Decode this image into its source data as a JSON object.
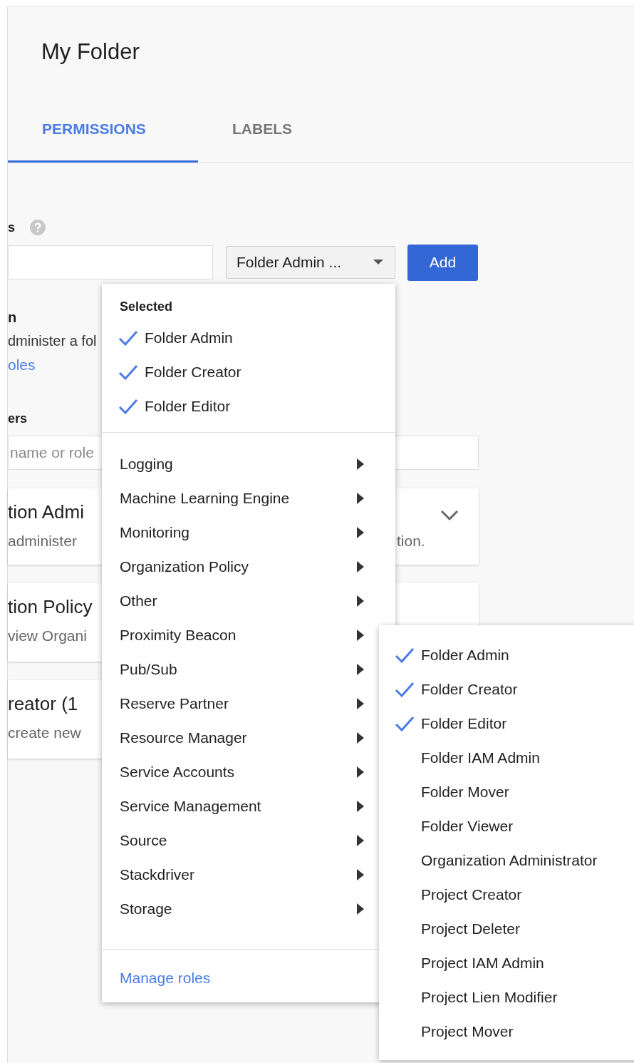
{
  "title": "My Folder",
  "tabs": [
    {
      "label": "PERMISSIONS",
      "selected": true
    },
    {
      "label": "LABELS",
      "selected": false
    }
  ],
  "add_members": {
    "label": "s",
    "role_dropdown": "Folder Admin ...",
    "add_button": "Add"
  },
  "role_info": {
    "title": "n",
    "description": "dminister a fol",
    "link": "oles"
  },
  "members": {
    "label": "ers",
    "filter_placeholder": "name or role"
  },
  "role_cards": [
    {
      "title": "tion Admi",
      "description": "administer",
      "description_end": "tion.",
      "expanded": false
    },
    {
      "title": "tion Policy",
      "description": "view Organi"
    },
    {
      "title": "reator (1",
      "description": "create new"
    }
  ],
  "role_menu": {
    "selected_heading": "Selected",
    "selected": [
      {
        "label": "Folder Admin",
        "checked": true
      },
      {
        "label": "Folder Creator",
        "checked": true
      },
      {
        "label": "Folder Editor",
        "checked": true
      }
    ],
    "categories": [
      "Logging",
      "Machine Learning Engine",
      "Monitoring",
      "Organization Policy",
      "Other",
      "Proximity Beacon",
      "Pub/Sub",
      "Reserve Partner",
      "Resource Manager",
      "Service Accounts",
      "Service Management",
      "Source",
      "Stackdriver",
      "Storage"
    ],
    "manage_link": "Manage roles"
  },
  "submenu": [
    {
      "label": "Folder Admin",
      "checked": true
    },
    {
      "label": "Folder Creator",
      "checked": true
    },
    {
      "label": "Folder Editor",
      "checked": true
    },
    {
      "label": "Folder IAM Admin",
      "checked": false
    },
    {
      "label": "Folder Mover",
      "checked": false
    },
    {
      "label": "Folder Viewer",
      "checked": false
    },
    {
      "label": "Organization Administrator",
      "checked": false
    },
    {
      "label": "Project Creator",
      "checked": false
    },
    {
      "label": "Project Deleter",
      "checked": false
    },
    {
      "label": "Project IAM Admin",
      "checked": false
    },
    {
      "label": "Project Lien Modifier",
      "checked": false
    },
    {
      "label": "Project Mover",
      "checked": false
    }
  ]
}
